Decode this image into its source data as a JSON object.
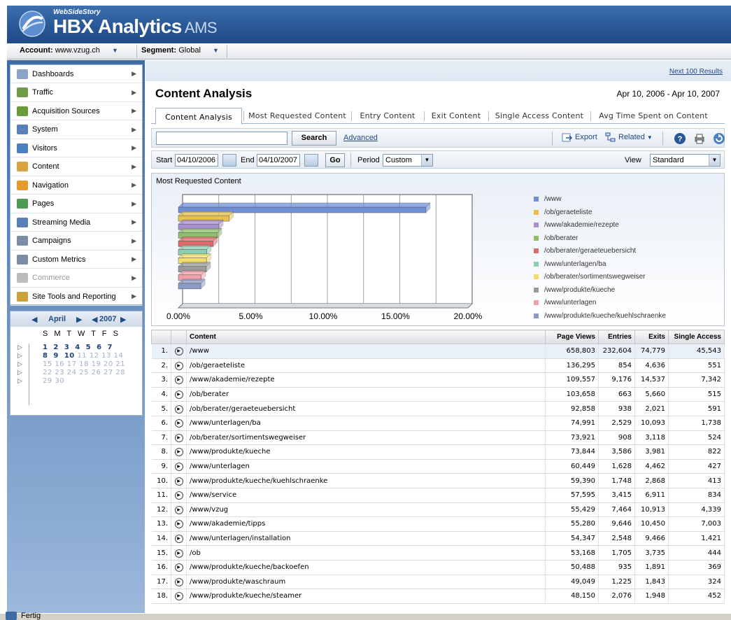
{
  "brand": {
    "small": "WebSideStory",
    "main": "HBX Analytics",
    "suffix": "AMS"
  },
  "account_bar": {
    "account_label": "Account:",
    "account_value": "www.vzug.ch",
    "segment_label": "Segment:",
    "segment_value": "Global"
  },
  "sidebar": {
    "items": [
      {
        "label": "Dashboards",
        "icon": "dashboards-icon",
        "color": "#8aa3c7"
      },
      {
        "label": "Traffic",
        "icon": "traffic-chart-icon",
        "color": "#6d9b4a"
      },
      {
        "label": "Acquisition Sources",
        "icon": "acquisition-icon",
        "color": "#6a9d3a"
      },
      {
        "label": "System",
        "icon": "monitor-icon",
        "color": "#5b7fb8"
      },
      {
        "label": "Visitors",
        "icon": "visitors-icon",
        "color": "#4a7fc0"
      },
      {
        "label": "Content",
        "icon": "document-icon",
        "color": "#d9a441"
      },
      {
        "label": "Navigation",
        "icon": "compass-icon",
        "color": "#e39b2b"
      },
      {
        "label": "Pages",
        "icon": "pages-icon",
        "color": "#4f9a55"
      },
      {
        "label": "Streaming Media",
        "icon": "media-icon",
        "color": "#5b7fb8"
      },
      {
        "label": "Campaigns",
        "icon": "campaigns-icon",
        "color": "#7a8ca6"
      },
      {
        "label": "Custom Metrics",
        "icon": "metrics-icon",
        "color": "#7a8ca6"
      },
      {
        "label": "Commerce",
        "icon": "dollar-icon",
        "color": "#bbbbbb",
        "disabled": true
      },
      {
        "label": "Site Tools and Reporting",
        "icon": "tools-icon",
        "color": "#c9a23c"
      }
    ]
  },
  "calendar": {
    "month": "April",
    "year": "2007",
    "days_header": "S M T W T F S",
    "rows": [
      {
        "active": "1  2  3  4  5  6  7",
        "dim": ""
      },
      {
        "active": "8  9  10",
        "dim": " 11 12 13 14"
      },
      {
        "active": "",
        "dim": "15 16 17 18 19 20 21"
      },
      {
        "active": "",
        "dim": "22 23 24 25 26 27 28"
      },
      {
        "active": "",
        "dim": "29 30"
      }
    ]
  },
  "content": {
    "next_link": "Next 100 Results",
    "title": "Content Analysis",
    "date_range": "Apr 10, 2006 - Apr 10, 2007",
    "tabs": [
      "Content Analysis",
      "Most Requested Content",
      "Entry Content",
      "Exit Content",
      "Single Access Content",
      "Avg Time Spent on Content"
    ],
    "search_button": "Search",
    "advanced_link": "Advanced",
    "export_label": "Export",
    "related_label": "Related",
    "start_label": "Start",
    "start_value": "04/10/2006",
    "end_label": "End",
    "end_value": "04/10/2007",
    "go_label": "Go",
    "period_label": "Period",
    "period_value": "Custom",
    "view_label": "View",
    "view_value": "Standard"
  },
  "chart_data": {
    "type": "bar",
    "orientation": "horizontal",
    "title": "Most Requested Content",
    "categories": [
      "/www",
      "/ob/geraeteliste",
      "/www/akademie/rezepte",
      "/ob/berater",
      "/ob/berater/geraeteuebersicht",
      "/www/unterlagen/ba",
      "/ob/berater/sortimentswegweiser",
      "/www/produkte/kueche",
      "/www/unterlagen",
      "/www/produkte/kueche/kuehlschraenke"
    ],
    "values": [
      17.1,
      3.5,
      2.8,
      2.7,
      2.4,
      1.96,
      1.94,
      1.93,
      1.58,
      1.55
    ],
    "colors": [
      "#6e8fd6",
      "#e8c14a",
      "#a98ed0",
      "#8fbf6a",
      "#e06a6a",
      "#8ccfb0",
      "#f2dc6a",
      "#9a9a9a",
      "#f2a0a8",
      "#8c9ac6"
    ],
    "x_ticks": [
      "0.00%",
      "5.00%",
      "10.00%",
      "15.00%",
      "20.00%"
    ],
    "xlim": [
      0,
      20
    ],
    "legend_position": "right",
    "grid": true
  },
  "table": {
    "columns": [
      "Content",
      "Page Views",
      "Entries",
      "Exits",
      "Single Access"
    ],
    "rows": [
      {
        "n": "1.",
        "content": "/www",
        "pv": "658,803",
        "entries": "232,604",
        "exits": "74,779",
        "single": "45,543"
      },
      {
        "n": "2.",
        "content": "/ob/geraeteliste",
        "pv": "136,295",
        "entries": "854",
        "exits": "4,636",
        "single": "551"
      },
      {
        "n": "3.",
        "content": "/www/akademie/rezepte",
        "pv": "109,557",
        "entries": "9,176",
        "exits": "14,537",
        "single": "7,342"
      },
      {
        "n": "4.",
        "content": "/ob/berater",
        "pv": "103,658",
        "entries": "663",
        "exits": "5,660",
        "single": "515"
      },
      {
        "n": "5.",
        "content": "/ob/berater/geraeteuebersicht",
        "pv": "92,858",
        "entries": "938",
        "exits": "2,021",
        "single": "591"
      },
      {
        "n": "6.",
        "content": "/www/unterlagen/ba",
        "pv": "74,991",
        "entries": "2,529",
        "exits": "10,093",
        "single": "1,738"
      },
      {
        "n": "7.",
        "content": "/ob/berater/sortimentswegweiser",
        "pv": "73,921",
        "entries": "908",
        "exits": "3,118",
        "single": "524"
      },
      {
        "n": "8.",
        "content": "/www/produkte/kueche",
        "pv": "73,844",
        "entries": "3,586",
        "exits": "3,981",
        "single": "822"
      },
      {
        "n": "9.",
        "content": "/www/unterlagen",
        "pv": "60,449",
        "entries": "1,628",
        "exits": "4,462",
        "single": "427"
      },
      {
        "n": "10.",
        "content": "/www/produkte/kueche/kuehlschraenke",
        "pv": "59,390",
        "entries": "1,748",
        "exits": "2,868",
        "single": "413"
      },
      {
        "n": "11.",
        "content": "/www/service",
        "pv": "57,595",
        "entries": "3,415",
        "exits": "6,911",
        "single": "834"
      },
      {
        "n": "12.",
        "content": "/www/vzug",
        "pv": "55,429",
        "entries": "7,464",
        "exits": "10,913",
        "single": "4,339"
      },
      {
        "n": "13.",
        "content": "/www/akademie/tipps",
        "pv": "55,280",
        "entries": "9,646",
        "exits": "10,450",
        "single": "7,003"
      },
      {
        "n": "14.",
        "content": "/www/unterlagen/installation",
        "pv": "54,347",
        "entries": "2,548",
        "exits": "9,466",
        "single": "1,421"
      },
      {
        "n": "15.",
        "content": "/ob",
        "pv": "53,168",
        "entries": "1,705",
        "exits": "3,735",
        "single": "444"
      },
      {
        "n": "16.",
        "content": "/www/produkte/kueche/backoefen",
        "pv": "50,488",
        "entries": "935",
        "exits": "1,891",
        "single": "369"
      },
      {
        "n": "17.",
        "content": "/www/produkte/waschraum",
        "pv": "49,049",
        "entries": "1,225",
        "exits": "1,843",
        "single": "324"
      },
      {
        "n": "18.",
        "content": "/www/produkte/kueche/steamer",
        "pv": "48,150",
        "entries": "2,076",
        "exits": "1,948",
        "single": "452"
      }
    ]
  },
  "status": {
    "text": "Fertig"
  }
}
